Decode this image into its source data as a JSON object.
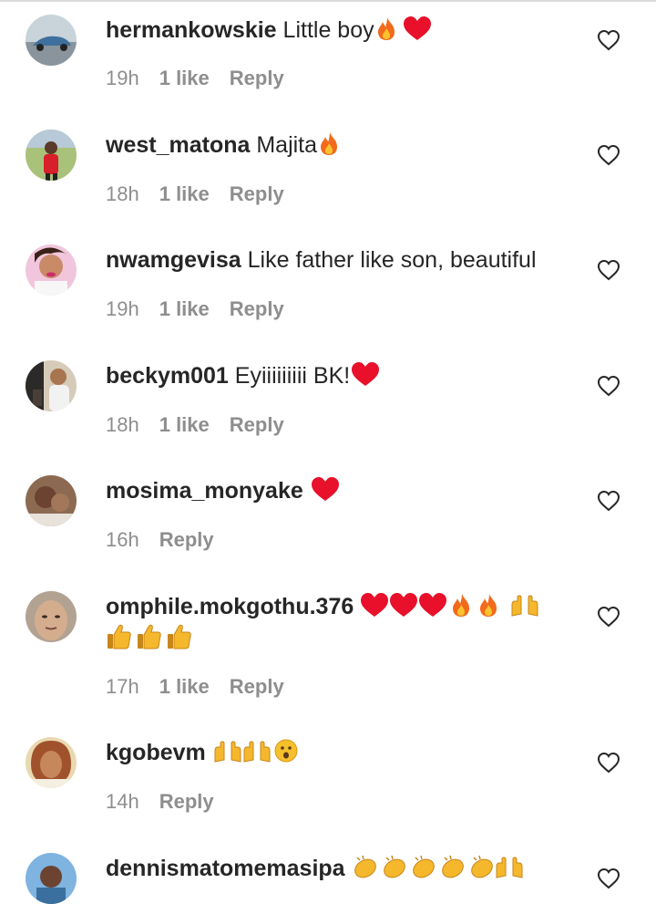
{
  "comments": [
    {
      "username": "hermankowskie",
      "text": "Little boy",
      "emojis": [
        "fire",
        "red-heart"
      ],
      "time": "19h",
      "likes": "1 like",
      "reply": "Reply",
      "avatar_color": "#8fa3b0"
    },
    {
      "username": "west_matona",
      "text": "Majita",
      "emojis": [
        "fire"
      ],
      "time": "18h",
      "likes": "1 like",
      "reply": "Reply",
      "avatar_color": "#7a9a5c"
    },
    {
      "username": "nwamgevisa",
      "text": "Like father like son, beautiful",
      "emojis": [],
      "time": "19h",
      "likes": "1 like",
      "reply": "Reply",
      "avatar_color": "#e07ab0"
    },
    {
      "username": "beckym001",
      "text": "Eyiiiiiiiii BK!",
      "emojis": [
        "red-heart"
      ],
      "time": "18h",
      "likes": "1 like",
      "reply": "Reply",
      "avatar_color": "#b9a88f"
    },
    {
      "username": "mosima_monyake",
      "text": "",
      "emojis": [
        "red-heart"
      ],
      "time": "16h",
      "likes": "",
      "reply": "Reply",
      "avatar_color": "#8a6a55"
    },
    {
      "username": "omphile.mokgothu.376",
      "text": "",
      "emojis": [
        "red-heart",
        "red-heart",
        "red-heart",
        "fire",
        "fire",
        "raising-hands",
        "thumbs-up",
        "thumbs-up",
        "thumbs-up"
      ],
      "time": "17h",
      "likes": "1 like",
      "reply": "Reply",
      "avatar_color": "#c8a48a"
    },
    {
      "username": "kgobevm",
      "text": "",
      "emojis": [
        "raising-hands",
        "raising-hands",
        "hushed-face"
      ],
      "time": "14h",
      "likes": "",
      "reply": "Reply",
      "avatar_color": "#a86a3a"
    },
    {
      "username": "dennismatomemasipa",
      "text": "",
      "emojis": [
        "clapping-hands",
        "clapping-hands",
        "clapping-hands",
        "clapping-hands",
        "clapping-hands",
        "raising-hands"
      ],
      "time": "",
      "likes": "",
      "reply": "",
      "avatar_color": "#5a8cc0"
    }
  ],
  "colors": {
    "text": "#262626",
    "meta": "#8e8e8e",
    "heart_outline": "#262626",
    "emoji_heart": "#e8102a",
    "emoji_fire": "#f26a1b",
    "emoji_yellow": "#f5b72c"
  }
}
